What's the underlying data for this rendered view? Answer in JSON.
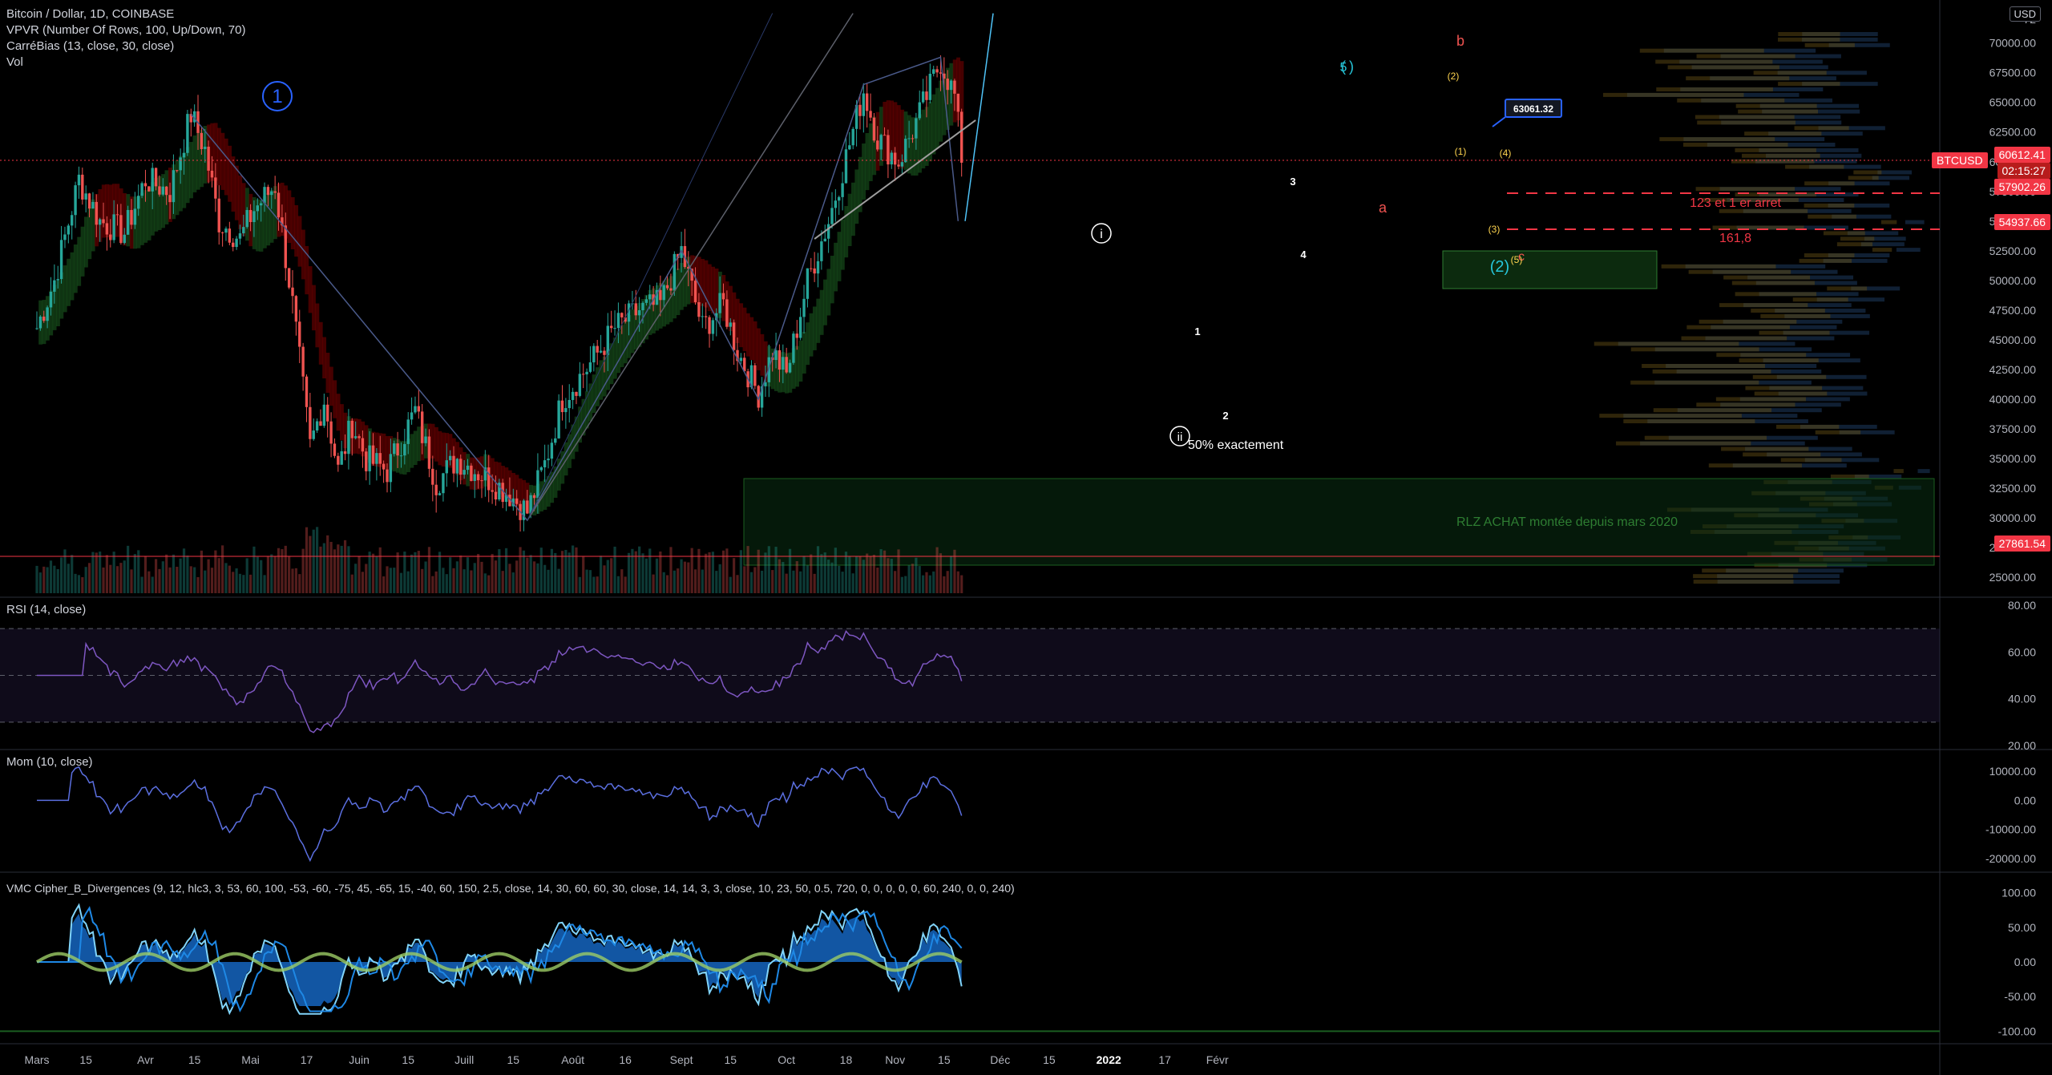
{
  "header": {
    "symbol_line": "Bitcoin / Dollar, 1D, COINBASE",
    "indicators": [
      "VPVR (Number Of Rows, 100, Up/Down, 70)",
      "CarréBias (13, close, 30, close)",
      "Vol"
    ],
    "currency_button": "USD"
  },
  "panes": {
    "rsi_title": "RSI (14, close)",
    "mom_title": "Mom (10, close)",
    "vmc_title": "VMC Cipher_B_Divergences (9, 12, hlc3, 3, 53, 60, 100, -53, -60, -75, 45, -65, 15, -40, 60, 150, 2.5, close, 14, 30, 60, 60, 30, close, 14, 14, 3, 3, close, 10, 23, 50, 0.5, 720, 0, 0, 0, 0, 0, 60, 240, 0, 0, 240)"
  },
  "price_axis": {
    "labels": [
      "72",
      "70000.00",
      "67500.00",
      "65000.00",
      "62500.00",
      "60000.00",
      "57500.00",
      "55000.00",
      "52500.00",
      "50000.00",
      "47500.00",
      "45000.00",
      "42500.00",
      "40000.00",
      "37500.00",
      "35000.00",
      "32500.00",
      "30000.00",
      "27500.00",
      "25000.00"
    ],
    "values": [
      72000,
      70000,
      67500,
      65000,
      62500,
      60000,
      57500,
      55000,
      52500,
      50000,
      47500,
      45000,
      42500,
      40000,
      37500,
      35000,
      32500,
      30000,
      27500,
      25000
    ]
  },
  "price_tags": [
    {
      "label": "60612.41",
      "sub": "02:15:27",
      "value": 60612.41,
      "color": "#f23645",
      "name": "current-price-tag"
    },
    {
      "label": "57902.26",
      "value": 57902.26,
      "color": "#f23645",
      "name": "target-1-price-tag"
    },
    {
      "label": "54937.66",
      "value": 54937.66,
      "color": "#f23645",
      "name": "target-2-price-tag"
    },
    {
      "label": "27861.54",
      "value": 27861.54,
      "color": "#f23645",
      "name": "support-price-tag"
    }
  ],
  "symbol_tag": "BTCUSD",
  "callout_price": "63061.32",
  "rsi_axis": {
    "labels": [
      "80.00",
      "60.00",
      "40.00",
      "20.00"
    ],
    "values": [
      80,
      60,
      40,
      20
    ]
  },
  "mom_axis": {
    "labels": [
      "10000.00",
      "0.00",
      "-10000.00",
      "-20000.00"
    ],
    "values": [
      10000,
      0,
      -10000,
      -20000
    ]
  },
  "vmc_axis": {
    "labels": [
      "100.00",
      "50.00",
      "0.00",
      "-50.00",
      "-100.00"
    ],
    "values": [
      100,
      50,
      0,
      -50,
      -100
    ]
  },
  "time_axis": {
    "labels": [
      "Mars",
      "15",
      "Avr",
      "15",
      "Mai",
      "17",
      "Juin",
      "15",
      "Juill",
      "15",
      "Août",
      "16",
      "Sept",
      "15",
      "Oct",
      "18",
      "Nov",
      "15",
      "Déc",
      "15",
      "2022",
      "17",
      "Févr"
    ],
    "days": [
      0,
      14,
      31,
      45,
      61,
      77,
      92,
      106,
      122,
      136,
      153,
      168,
      184,
      198,
      214,
      231,
      245,
      259,
      275,
      289,
      306,
      322,
      337
    ]
  },
  "annotations": {
    "wave_1": "1",
    "wave_i": "i",
    "wave_ii": "ii",
    "wave_5_top": "5",
    "wave_2_big": "(2)",
    "label_b": "b",
    "label_a": "a",
    "label_c": "c",
    "sub_1": "1",
    "sub_2": "2",
    "sub_3": "3",
    "sub_4": "4",
    "paren_1": "(1)",
    "paren_2": "(2)",
    "paren_3": "(3)",
    "paren_4": "(4)",
    "paren_5": "(5)",
    "fifty_pct": "50% exactement",
    "target_text_1": "123 et 1 er arret",
    "target_text_2": "161,8",
    "rlz_text": "RLZ ACHAT montée depuis mars 2020"
  },
  "colors": {
    "up": "#26a69a",
    "down": "#ef5350",
    "rsi": "#7e57c2",
    "mom": "#5b6fe0",
    "ma_cloud_green": "#1b5e20",
    "ma_cloud_red": "#7f0000",
    "dashed_red": "#f23645",
    "wave_blue": "#2962ff"
  },
  "chart_data": {
    "type": "candlestick",
    "x_unit": "days since 1 March 2021",
    "anchors": [
      [
        0,
        46000
      ],
      [
        5,
        50000
      ],
      [
        12,
        58500
      ],
      [
        18,
        55000
      ],
      [
        25,
        54000
      ],
      [
        31,
        58500
      ],
      [
        38,
        57500
      ],
      [
        44,
        64000
      ],
      [
        48,
        61000
      ],
      [
        52,
        55000
      ],
      [
        58,
        53500
      ],
      [
        62,
        56000
      ],
      [
        68,
        58000
      ],
      [
        73,
        48000
      ],
      [
        78,
        36000
      ],
      [
        82,
        40000
      ],
      [
        86,
        34000
      ],
      [
        90,
        38000
      ],
      [
        94,
        35000
      ],
      [
        100,
        34000
      ],
      [
        108,
        39000
      ],
      [
        114,
        33000
      ],
      [
        120,
        35000
      ],
      [
        128,
        33500
      ],
      [
        135,
        32000
      ],
      [
        140,
        30500
      ],
      [
        145,
        34500
      ],
      [
        150,
        40000
      ],
      [
        158,
        43000
      ],
      [
        165,
        46000
      ],
      [
        172,
        47500
      ],
      [
        178,
        48000
      ],
      [
        184,
        52500
      ],
      [
        190,
        46000
      ],
      [
        196,
        48000
      ],
      [
        200,
        44000
      ],
      [
        206,
        40500
      ],
      [
        210,
        44000
      ],
      [
        214,
        42000
      ],
      [
        220,
        50000
      ],
      [
        226,
        55000
      ],
      [
        232,
        61500
      ],
      [
        236,
        66000
      ],
      [
        240,
        62000
      ],
      [
        246,
        60000
      ],
      [
        252,
        64000
      ],
      [
        258,
        68500
      ],
      [
        262,
        65500
      ],
      [
        264,
        60500
      ]
    ]
  }
}
